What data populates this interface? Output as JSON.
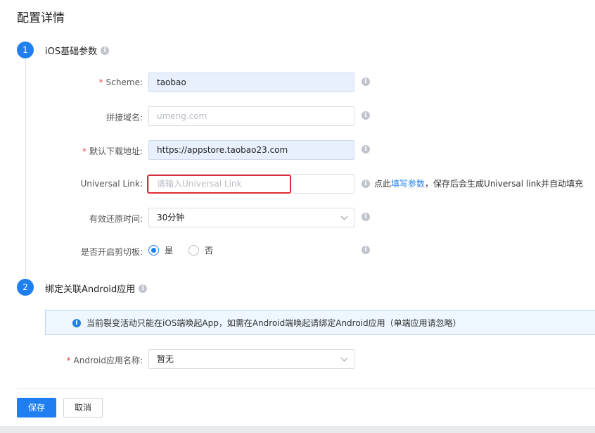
{
  "page": {
    "title": "配置详情"
  },
  "steps": [
    {
      "number": "1",
      "title": "iOS基础参数"
    },
    {
      "number": "2",
      "title": "绑定关联Android应用"
    }
  ],
  "ios": {
    "scheme": {
      "label": "Scheme",
      "required": "*",
      "value": "taobao"
    },
    "domain": {
      "label": "拼接域名",
      "placeholder": "umeng.com"
    },
    "download": {
      "label": "默认下载地址",
      "required": "*",
      "value": "https://appstore.taobao23.com"
    },
    "universal_link": {
      "label": "Universal Link",
      "placeholder": "请输入Universal Link",
      "hint_prefix": "点此",
      "hint_link": "填写参数",
      "hint_suffix": "，保存后会生成Universal link并自动填充"
    },
    "restore_time": {
      "label": "有效还原时间",
      "value": "30分钟"
    },
    "clipboard": {
      "label": "是否开启剪切板",
      "option_yes": "是",
      "option_no": "否",
      "selected": "是"
    }
  },
  "android": {
    "banner": "当前裂变活动只能在iOS端唤起App，如需在Android端唤起请绑定Android应用（单端应用请忽略）",
    "app_name": {
      "label": "Android应用名称",
      "required": "*",
      "value": "暂无"
    }
  },
  "footer": {
    "save_label": "保存",
    "cancel_label": "取消"
  },
  "colors": {
    "accent": "#1f7ff0",
    "required": "#f04848",
    "highlight": "#e02a36"
  },
  "icons": {
    "info": "info-icon",
    "chevron": "chevron-down-icon"
  }
}
